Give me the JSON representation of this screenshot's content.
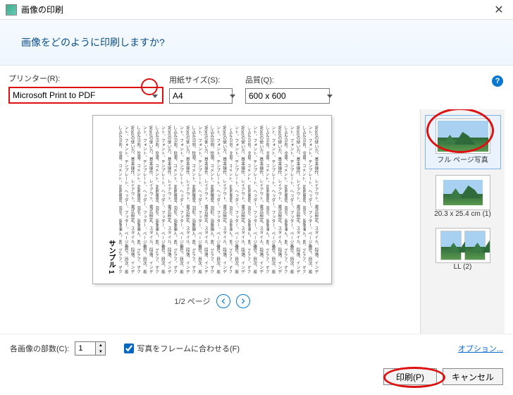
{
  "window": {
    "title": "画像の印刷"
  },
  "header": {
    "question": "画像をどのように印刷しますか?"
  },
  "controls": {
    "printer": {
      "label": "プリンター(R):",
      "value": "Microsoft Print to PDF"
    },
    "paper_size": {
      "label": "用紙サイズ(S):",
      "value": "A4"
    },
    "quality": {
      "label": "品質(Q):",
      "value": "600 x 600"
    }
  },
  "preview": {
    "sample_label": "サンプル 1",
    "page_indicator": "1/2 ページ",
    "filler": "Wordの使い方、基本操作、レイアウト、書式設定、スタイル、段落、インデント、フォント、テンプレート、ヘッダー、フッター、ページ番号、目次、差し込み印刷、校閲、コメント、変更履歴、図形、画像挿入、表、グラフ、マクロなど多くの機能があります。各機能の使い方を覚えることで文書作成の効率が大幅に向上します。"
  },
  "layouts": [
    {
      "id": "full",
      "label": "フル ページ写真",
      "selected": true
    },
    {
      "id": "contact",
      "label": "20.3 x 25.4 cm (1)",
      "selected": false
    },
    {
      "id": "ll2",
      "label": "LL (2)",
      "selected": false
    }
  ],
  "footer": {
    "copies_label": "各画像の部数(C):",
    "copies_value": "1",
    "fit_frame_label": "写真をフレームに合わせる(F)",
    "fit_frame_checked": true,
    "options_link": "オプション..."
  },
  "buttons": {
    "print": "印刷(P)",
    "cancel": "キャンセル"
  }
}
